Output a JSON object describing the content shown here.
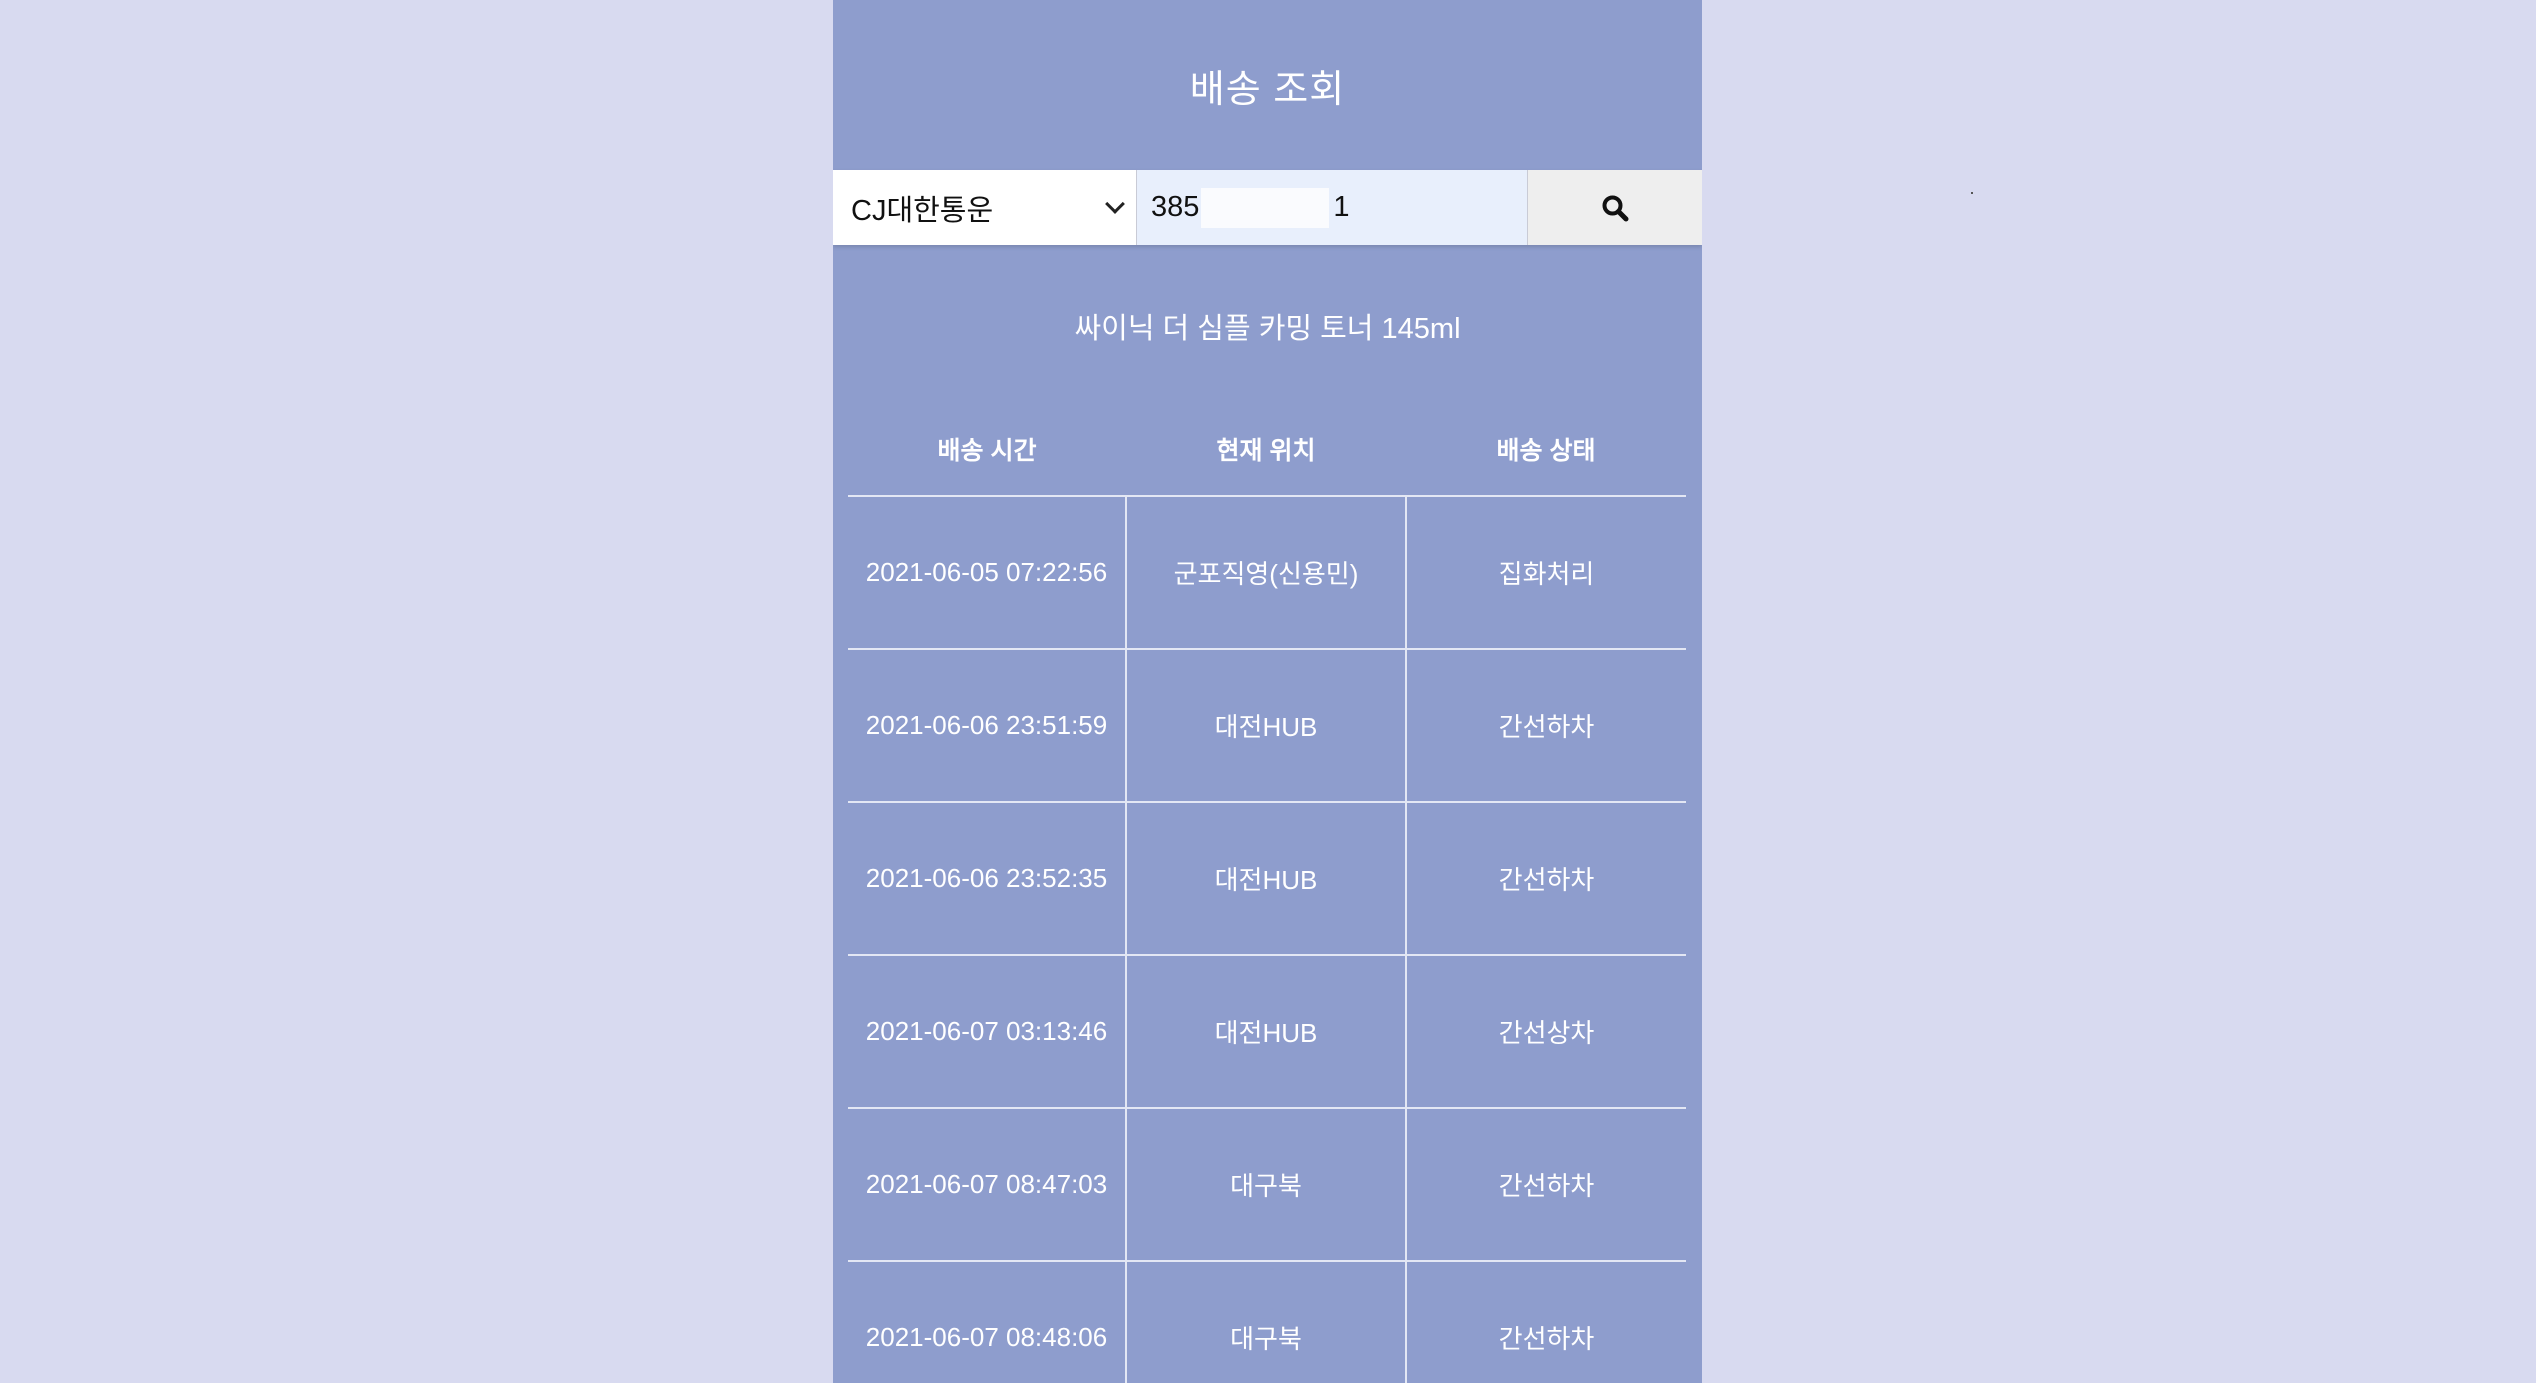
{
  "header": {
    "title": "배송 조회"
  },
  "search": {
    "carrier": "CJ대한통운",
    "tracking_prefix": "385",
    "tracking_suffix": "1",
    "search_icon": "search-icon"
  },
  "product": {
    "name": "싸이닉 더 심플 카밍 토너 145ml"
  },
  "table": {
    "headers": [
      "배송 시간",
      "현재 위치",
      "배송 상태"
    ],
    "rows": [
      [
        "2021-06-05 07:22:56",
        "군포직영(신용민)",
        "집화처리"
      ],
      [
        "2021-06-06 23:51:59",
        "대전HUB",
        "간선하차"
      ],
      [
        "2021-06-06 23:52:35",
        "대전HUB",
        "간선하차"
      ],
      [
        "2021-06-07 03:13:46",
        "대전HUB",
        "간선상차"
      ],
      [
        "2021-06-07 08:47:03",
        "대구북",
        "간선하차"
      ],
      [
        "2021-06-07 08:48:06",
        "대구북",
        "간선하차"
      ]
    ]
  },
  "colors": {
    "page_bg": "#d8daf0",
    "panel_bg": "#8e9dcd",
    "input_bg": "#e8effc",
    "button_bg": "#eeeeee"
  }
}
